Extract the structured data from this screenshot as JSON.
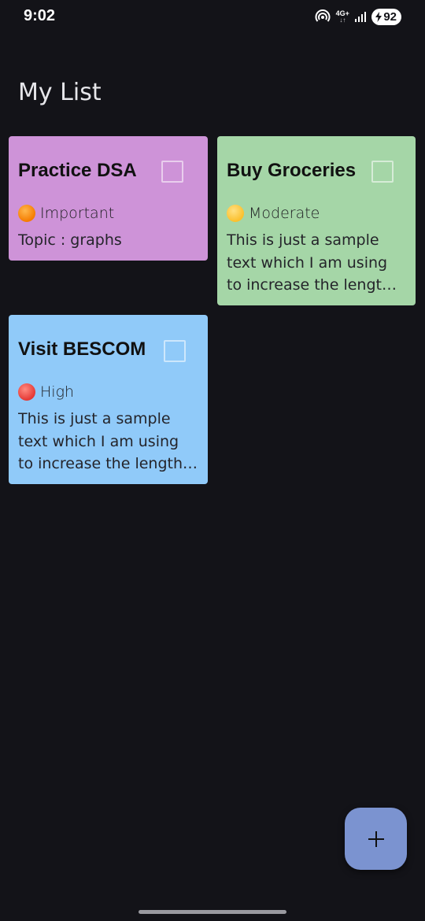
{
  "status_bar": {
    "time": "9:02",
    "network": "4G+",
    "network_arrows": "↓↑",
    "battery": "92",
    "icons": [
      "hotspot-icon",
      "signal-icon",
      "battery-charging-icon"
    ]
  },
  "header": {
    "title": "My List"
  },
  "tasks": [
    {
      "title": "Practice DSA",
      "priority": "Important",
      "priority_color": "#f57c00",
      "description": "Topic : graphs",
      "card_color": "#ce93d8",
      "checked": false
    },
    {
      "title": "Buy Groceries",
      "priority": "Moderate",
      "priority_color": "#fbc02d",
      "description": "This is just a sample text which I am using to increase the length of the text",
      "card_color": "#a5d6a7",
      "checked": false
    },
    {
      "title": "Visit BESCOM",
      "priority": "High",
      "priority_color": "#e53935",
      "description": "This is just a sample text which I am using to increase the length of the text",
      "card_color": "#90caf9",
      "checked": false
    }
  ],
  "fab": {
    "icon": "plus-icon",
    "color": "#7b93d0"
  }
}
